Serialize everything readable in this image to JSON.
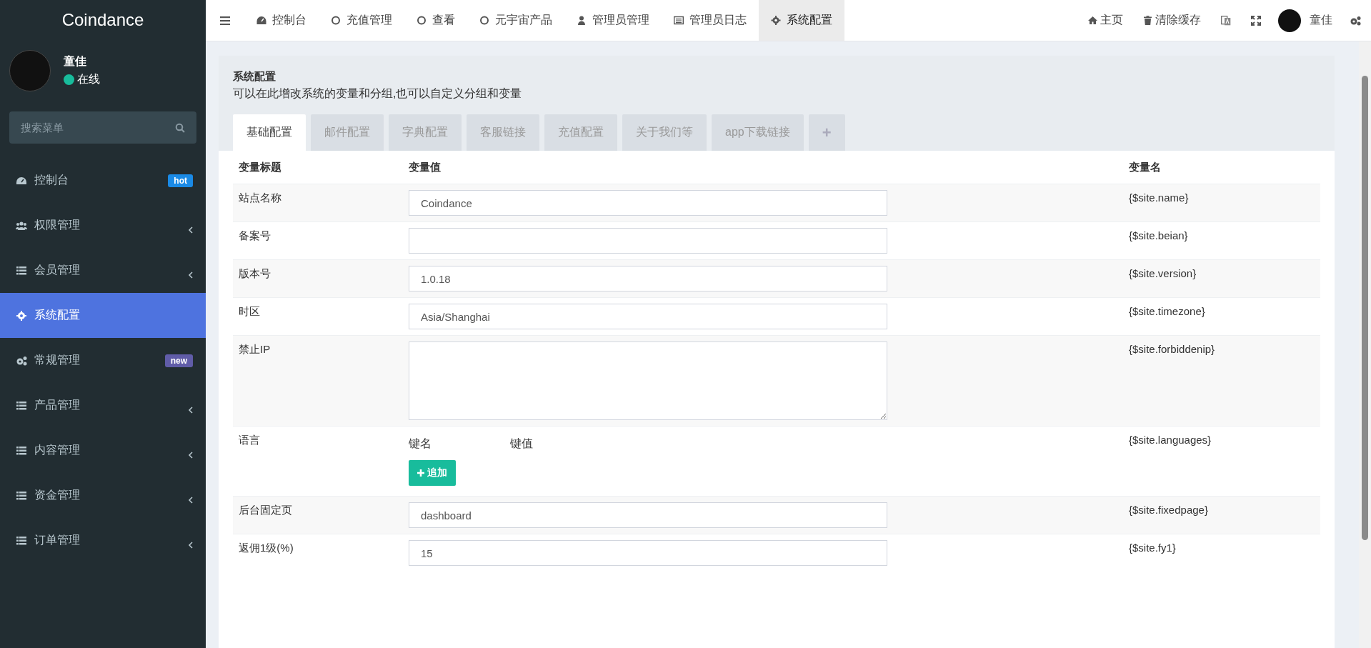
{
  "brand": "Coindance",
  "user": {
    "name": "童佳",
    "status": "在线"
  },
  "menu_search": {
    "placeholder": "搜索菜单"
  },
  "sidebar": {
    "items": [
      {
        "label": "控制台",
        "badge": {
          "text": "hot",
          "color": "#1a8ae6"
        },
        "expandable": false,
        "selected": false
      },
      {
        "label": "权限管理",
        "expandable": true,
        "selected": false
      },
      {
        "label": "会员管理",
        "expandable": true,
        "selected": false
      },
      {
        "label": "系统配置",
        "expandable": false,
        "selected": true
      },
      {
        "label": "常规管理",
        "badge": {
          "text": "new",
          "color": "#605ca8"
        },
        "expandable": false,
        "selected": false
      },
      {
        "label": "产品管理",
        "expandable": true,
        "selected": false
      },
      {
        "label": "内容管理",
        "expandable": true,
        "selected": false
      },
      {
        "label": "资金管理",
        "expandable": true,
        "selected": false
      },
      {
        "label": "订单管理",
        "expandable": true,
        "selected": false
      }
    ]
  },
  "top_tabs": [
    {
      "label": "控制台",
      "selected": false
    },
    {
      "label": "充值管理",
      "selected": false
    },
    {
      "label": "查看",
      "selected": false
    },
    {
      "label": "元宇宙产品",
      "selected": false
    },
    {
      "label": "管理员管理",
      "selected": false
    },
    {
      "label": "管理员日志",
      "selected": false
    },
    {
      "label": "系统配置",
      "selected": true
    }
  ],
  "top_links": [
    {
      "label": "主页"
    },
    {
      "label": "清除缓存"
    }
  ],
  "top_user": "童佳",
  "panel": {
    "title": "系统配置",
    "description": "可以在此增改系统的变量和分组,也可以自定义分组和变量",
    "tabs": [
      {
        "label": "基础配置",
        "selected": true
      },
      {
        "label": "邮件配置",
        "selected": false
      },
      {
        "label": "字典配置",
        "selected": false
      },
      {
        "label": "客服链接",
        "selected": false
      },
      {
        "label": "充值配置",
        "selected": false
      },
      {
        "label": "关于我们等",
        "selected": false
      },
      {
        "label": "app下载链接",
        "selected": false
      }
    ],
    "add_tab": "+"
  },
  "table": {
    "columns": [
      "变量标题",
      "变量值",
      "变量名"
    ],
    "rows": [
      {
        "kind": "input",
        "label": "站点名称",
        "value": "Coindance",
        "variable": "{$site.name}"
      },
      {
        "kind": "input",
        "label": "备案号",
        "variable": "{$site.beian}"
      },
      {
        "kind": "input",
        "label": "版本号",
        "value": "1.0.18",
        "variable": "{$site.version}"
      },
      {
        "kind": "input",
        "label": "时区",
        "value": "Asia/Shanghai",
        "variable": "{$site.timezone}"
      },
      {
        "kind": "textarea",
        "label": "禁止IP",
        "variable": "{$site.forbiddenip}"
      },
      {
        "kind": "pairs",
        "label": "语言",
        "pair_columns": [
          "键名",
          "键值"
        ],
        "add_button": "追加",
        "variable": "{$site.languages}"
      },
      {
        "kind": "input",
        "label": "后台固定页",
        "value": "dashboard",
        "variable": "{$site.fixedpage}"
      },
      {
        "kind": "input",
        "label": "返佣1级(%)",
        "value": "15",
        "variable": "{$site.fy1}"
      }
    ]
  }
}
